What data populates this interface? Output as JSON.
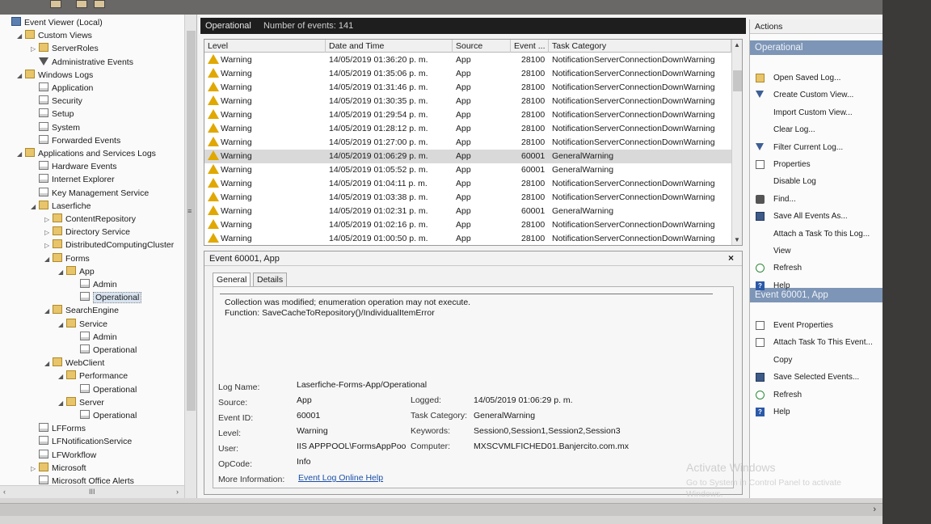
{
  "tree": {
    "items": [
      {
        "label": "Event Viewer (Local)",
        "indent": 0,
        "icon": "event-viewer-icon",
        "exp": ""
      },
      {
        "label": "Custom Views",
        "indent": 1,
        "icon": "folder-icon",
        "exp": "◢"
      },
      {
        "label": "ServerRoles",
        "indent": 2,
        "icon": "folder-icon",
        "exp": "▷"
      },
      {
        "label": "Administrative Events",
        "indent": 2,
        "icon": "filter-icon",
        "exp": ""
      },
      {
        "label": "Windows Logs",
        "indent": 1,
        "icon": "folder-icon",
        "exp": "◢"
      },
      {
        "label": "Application",
        "indent": 2,
        "icon": "log-icon",
        "exp": ""
      },
      {
        "label": "Security",
        "indent": 2,
        "icon": "log-icon",
        "exp": ""
      },
      {
        "label": "Setup",
        "indent": 2,
        "icon": "log-icon",
        "exp": ""
      },
      {
        "label": "System",
        "indent": 2,
        "icon": "log-icon",
        "exp": ""
      },
      {
        "label": "Forwarded Events",
        "indent": 2,
        "icon": "log-icon",
        "exp": ""
      },
      {
        "label": "Applications and Services Logs",
        "indent": 1,
        "icon": "folder-icon",
        "exp": "◢"
      },
      {
        "label": "Hardware Events",
        "indent": 2,
        "icon": "log-icon",
        "exp": ""
      },
      {
        "label": "Internet Explorer",
        "indent": 2,
        "icon": "log-icon",
        "exp": ""
      },
      {
        "label": "Key Management Service",
        "indent": 2,
        "icon": "log-icon",
        "exp": ""
      },
      {
        "label": "Laserfiche",
        "indent": 2,
        "icon": "folder-icon",
        "exp": "◢"
      },
      {
        "label": "ContentRepository",
        "indent": 3,
        "icon": "folder-icon",
        "exp": "▷"
      },
      {
        "label": "Directory Service",
        "indent": 3,
        "icon": "folder-icon",
        "exp": "▷"
      },
      {
        "label": "DistributedComputingCluster",
        "indent": 3,
        "icon": "folder-icon",
        "exp": "▷"
      },
      {
        "label": "Forms",
        "indent": 3,
        "icon": "folder-icon",
        "exp": "◢"
      },
      {
        "label": "App",
        "indent": 4,
        "icon": "folder-icon",
        "exp": "◢"
      },
      {
        "label": "Admin",
        "indent": 5,
        "icon": "log-icon",
        "exp": ""
      },
      {
        "label": "Operational",
        "indent": 5,
        "icon": "log-icon",
        "exp": "",
        "selected": true
      },
      {
        "label": "SearchEngine",
        "indent": 3,
        "icon": "folder-icon",
        "exp": "◢"
      },
      {
        "label": "Service",
        "indent": 4,
        "icon": "folder-icon",
        "exp": "◢"
      },
      {
        "label": "Admin",
        "indent": 5,
        "icon": "log-icon",
        "exp": ""
      },
      {
        "label": "Operational",
        "indent": 5,
        "icon": "log-icon",
        "exp": ""
      },
      {
        "label": "WebClient",
        "indent": 3,
        "icon": "folder-icon",
        "exp": "◢"
      },
      {
        "label": "Performance",
        "indent": 4,
        "icon": "folder-icon",
        "exp": "◢"
      },
      {
        "label": "Operational",
        "indent": 5,
        "icon": "log-icon",
        "exp": ""
      },
      {
        "label": "Server",
        "indent": 4,
        "icon": "folder-icon",
        "exp": "◢"
      },
      {
        "label": "Operational",
        "indent": 5,
        "icon": "log-icon",
        "exp": ""
      },
      {
        "label": "LFForms",
        "indent": 2,
        "icon": "log-icon",
        "exp": ""
      },
      {
        "label": "LFNotificationService",
        "indent": 2,
        "icon": "log-icon",
        "exp": ""
      },
      {
        "label": "LFWorkflow",
        "indent": 2,
        "icon": "log-icon",
        "exp": ""
      },
      {
        "label": "Microsoft",
        "indent": 2,
        "icon": "folder-icon",
        "exp": "▷"
      },
      {
        "label": "Microsoft Office Alerts",
        "indent": 2,
        "icon": "log-icon",
        "exp": ""
      }
    ],
    "scroll_left": "‹",
    "scroll_mid": "III",
    "scroll_right": "›"
  },
  "center": {
    "title": "Operational",
    "count": "Number of events: 141",
    "columns": [
      "Level",
      "Date and Time",
      "Source",
      "Event ...",
      "Task Category"
    ],
    "rows": [
      {
        "level": "Warning",
        "date": "14/05/2019 01:36:20 p. m.",
        "source": "App",
        "id": "28100",
        "cat": "NotificationServerConnectionDownWarning"
      },
      {
        "level": "Warning",
        "date": "14/05/2019 01:35:06 p. m.",
        "source": "App",
        "id": "28100",
        "cat": "NotificationServerConnectionDownWarning"
      },
      {
        "level": "Warning",
        "date": "14/05/2019 01:31:46 p. m.",
        "source": "App",
        "id": "28100",
        "cat": "NotificationServerConnectionDownWarning"
      },
      {
        "level": "Warning",
        "date": "14/05/2019 01:30:35 p. m.",
        "source": "App",
        "id": "28100",
        "cat": "NotificationServerConnectionDownWarning"
      },
      {
        "level": "Warning",
        "date": "14/05/2019 01:29:54 p. m.",
        "source": "App",
        "id": "28100",
        "cat": "NotificationServerConnectionDownWarning"
      },
      {
        "level": "Warning",
        "date": "14/05/2019 01:28:12 p. m.",
        "source": "App",
        "id": "28100",
        "cat": "NotificationServerConnectionDownWarning"
      },
      {
        "level": "Warning",
        "date": "14/05/2019 01:27:00 p. m.",
        "source": "App",
        "id": "28100",
        "cat": "NotificationServerConnectionDownWarning"
      },
      {
        "level": "Warning",
        "date": "14/05/2019 01:06:29 p. m.",
        "source": "App",
        "id": "60001",
        "cat": "GeneralWarning",
        "selected": true
      },
      {
        "level": "Warning",
        "date": "14/05/2019 01:05:52 p. m.",
        "source": "App",
        "id": "60001",
        "cat": "GeneralWarning"
      },
      {
        "level": "Warning",
        "date": "14/05/2019 01:04:11 p. m.",
        "source": "App",
        "id": "28100",
        "cat": "NotificationServerConnectionDownWarning"
      },
      {
        "level": "Warning",
        "date": "14/05/2019 01:03:38 p. m.",
        "source": "App",
        "id": "28100",
        "cat": "NotificationServerConnectionDownWarning"
      },
      {
        "level": "Warning",
        "date": "14/05/2019 01:02:31 p. m.",
        "source": "App",
        "id": "60001",
        "cat": "GeneralWarning"
      },
      {
        "level": "Warning",
        "date": "14/05/2019 01:02:16 p. m.",
        "source": "App",
        "id": "28100",
        "cat": "NotificationServerConnectionDownWarning"
      },
      {
        "level": "Warning",
        "date": "14/05/2019 01:00:50 p. m.",
        "source": "App",
        "id": "28100",
        "cat": "NotificationServerConnectionDownWarning"
      }
    ],
    "grip_glyph": "≡"
  },
  "detail": {
    "title": "Event 60001, App",
    "close": "×",
    "tabs": [
      "General",
      "Details"
    ],
    "message_line1": "Collection was modified; enumeration operation may not execute.",
    "message_line2": "Function: SaveCacheToRepository()/IndividualItemError",
    "labels": {
      "log_name": "Log Name:",
      "source": "Source:",
      "event_id": "Event ID:",
      "level": "Level:",
      "user": "User:",
      "opcode": "OpCode:",
      "more_info": "More Information:",
      "logged": "Logged:",
      "task_category": "Task Category:",
      "keywords": "Keywords:",
      "computer": "Computer:"
    },
    "values": {
      "log_name": "Laserfiche-Forms-App/Operational",
      "source": "App",
      "event_id": "60001",
      "level": "Warning",
      "user": "IIS APPPOOL\\FormsAppPoo",
      "opcode": "Info",
      "more_info": "Event Log Online Help",
      "logged": "14/05/2019 01:06:29 p. m.",
      "task_category": "GeneralWarning",
      "keywords": "Session0,Session1,Session2,Session3",
      "computer": "MXSCVMLFICHED01.Banjercito.com.mx"
    }
  },
  "actions": {
    "header": "Actions",
    "section1": "Operational",
    "items1": [
      {
        "label": "Open Saved Log...",
        "icon": "open-icon"
      },
      {
        "label": "Create Custom View...",
        "icon": "filter-icon"
      },
      {
        "label": "Import Custom View...",
        "icon": ""
      },
      {
        "label": "Clear Log...",
        "icon": ""
      },
      {
        "label": "Filter Current Log...",
        "icon": "filter-icon"
      },
      {
        "label": "Properties",
        "icon": "properties-icon"
      },
      {
        "label": "Disable Log",
        "icon": ""
      },
      {
        "label": "Find...",
        "icon": "find-icon"
      },
      {
        "label": "Save All Events As...",
        "icon": "save-icon"
      },
      {
        "label": "Attach a Task To this Log...",
        "icon": ""
      },
      {
        "label": "View",
        "icon": ""
      },
      {
        "label": "Refresh",
        "icon": "refresh-icon"
      },
      {
        "label": "Help",
        "icon": "help-icon"
      }
    ],
    "section2": "Event 60001, App",
    "items2": [
      {
        "label": "Event Properties",
        "icon": "properties-icon"
      },
      {
        "label": "Attach Task To This Event...",
        "icon": "properties-icon"
      },
      {
        "label": "Copy",
        "icon": ""
      },
      {
        "label": "Save Selected Events...",
        "icon": "save-icon"
      },
      {
        "label": "Refresh",
        "icon": "refresh-icon"
      },
      {
        "label": "Help",
        "icon": "help-icon"
      }
    ],
    "help_glyph": "?"
  },
  "watermark": {
    "line1": "Activate Windows",
    "line2": "Go to System in Control Panel to activate Windows."
  }
}
